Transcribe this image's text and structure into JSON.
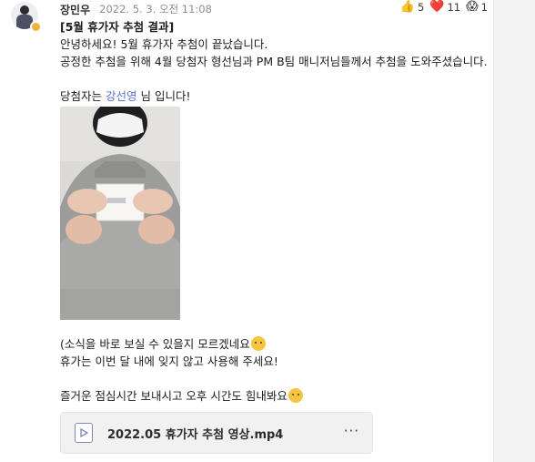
{
  "post": {
    "author": "장민우",
    "timestamp": "2022. 5. 3. 오전 11:08",
    "reactions": [
      {
        "icon": "thumbs-up-icon",
        "emoji": "👍",
        "count": "5"
      },
      {
        "icon": "heart-icon",
        "emoji": "❤️",
        "count": "11"
      },
      {
        "icon": "surprised-face-icon",
        "emoji": "😱",
        "count": "1"
      }
    ],
    "title": "[5월 휴가자 추첨 결과]",
    "lines": [
      "안녕하세요! 5월 휴가자 추첨이 끝났습니다.",
      "공정한 추첨을 위해 4월 당첨자 형선님과 PM B팀 매니저님들께서 추첨을 도와주셨습니다."
    ],
    "winner_prefix": "당첨자는 ",
    "winner_name": "강선영",
    "winner_suffix": " 님 입니다!",
    "after_lines": [
      "(소식을 바로 보실 수 있을지 모르겠네요",
      "휴가는 이번 달 내에 잊지 않고 사용해 주세요!",
      "즐거운 점심시간 보내시고 오후 시간도 힘내봐요"
    ],
    "attachment": {
      "file_name": "2022.05 휴가자 추첨 영상.mp4",
      "more_label": "···"
    }
  },
  "colors": {
    "mention": "#5b6fd6",
    "status_dot": "#f3b23c",
    "heart": "#e0245e"
  }
}
